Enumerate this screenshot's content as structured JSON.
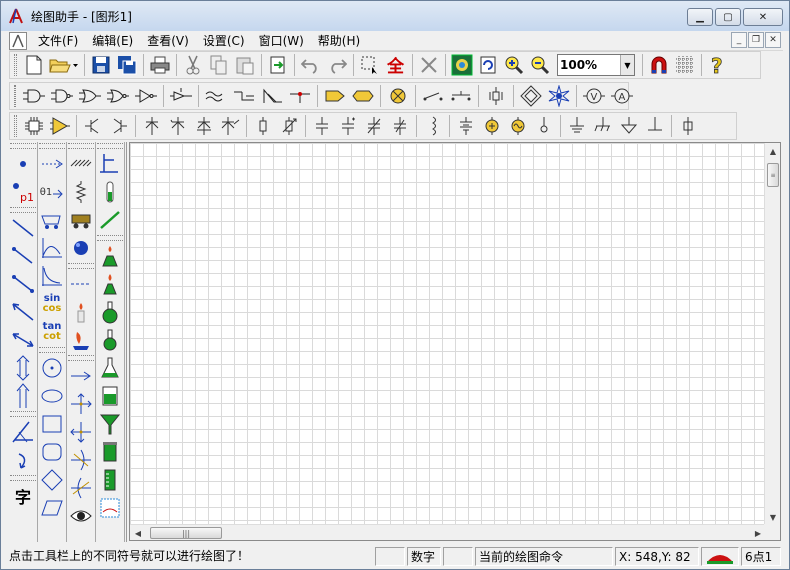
{
  "window": {
    "title": "绘图助手 - [图形1]"
  },
  "menu": {
    "items": [
      {
        "label": "文件(F)"
      },
      {
        "label": "编辑(E)"
      },
      {
        "label": "查看(V)"
      },
      {
        "label": "设置(C)"
      },
      {
        "label": "窗口(W)"
      },
      {
        "label": "帮助(H)"
      }
    ]
  },
  "toolbar1": {
    "zoom_value": "100%",
    "buttons": [
      "new-file-icon",
      "open-file-icon",
      "save-icon",
      "save-all-icon",
      "print-icon",
      "cut-icon",
      "copy-icon",
      "paste-icon",
      "export-icon",
      "undo-icon",
      "redo-icon",
      "select-icon",
      "select-all-icon",
      "delete-icon",
      "shape-library-icon",
      "refresh-icon",
      "zoom-in-icon",
      "zoom-out-icon",
      "magnet-icon",
      "grid-icon",
      "help-icon"
    ]
  },
  "palette": {
    "col1_labels": {
      "point_label": "p1",
      "text_char": "字"
    },
    "col2_labels": {
      "sin": "sin",
      "cos": "cos",
      "tan": "tan",
      "cot": "cot",
      "coord_label": "θ1"
    }
  },
  "status": {
    "hint": "点击工具栏上的不同符号就可以进行绘图了！",
    "empty_panel": "",
    "num_lock": "数字",
    "empty_panel2": "",
    "command": "当前的绘图命令",
    "coords": "X: 548,Y: 82",
    "points": "6点1"
  },
  "colors": {
    "accent_red": "#cc0000",
    "accent_blue": "#1a3fb4",
    "accent_green": "#1a9a2a"
  }
}
